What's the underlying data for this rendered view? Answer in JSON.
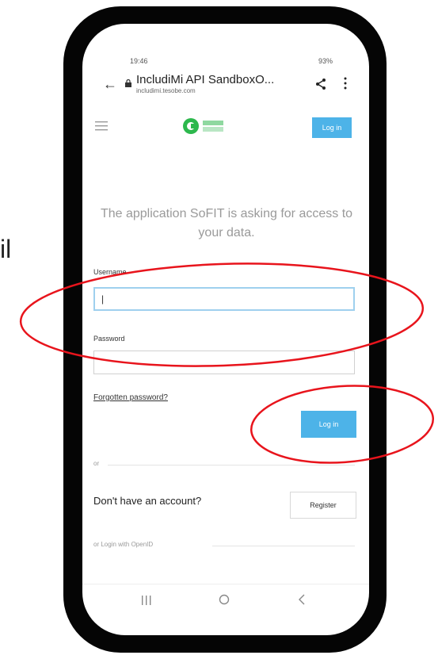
{
  "side_text": "il",
  "status_bar": {
    "time": "19:46",
    "icons_text": "93%"
  },
  "browser": {
    "title": "IncludiMi API SandboxO...",
    "url": "includimi.tesobe.com"
  },
  "header": {
    "login_label": "Log in"
  },
  "headline": "The application SoFIT is asking for access to your data.",
  "form": {
    "username_label": "Username",
    "username_value": "|",
    "password_label": "Password",
    "password_value": "",
    "forgot_label": "Forgotten password?",
    "login_label": "Log in"
  },
  "or_label": "or",
  "signup": {
    "prompt": "Don't have an account?",
    "register_label": "Register"
  },
  "openid_label": "or Login with OpenID",
  "colors": {
    "accent": "#4db3e8",
    "annotation": "#e8141c",
    "phone_frame": "#050505",
    "logo_green": "#2db84d"
  }
}
